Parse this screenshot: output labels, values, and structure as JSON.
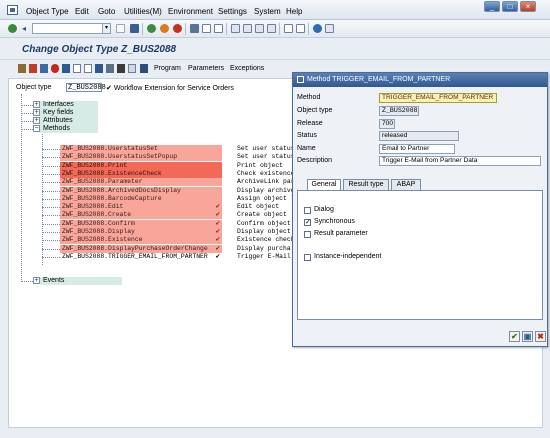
{
  "menubar": {
    "items": [
      "Object Type",
      "Edit",
      "Goto",
      "Utilities(M)",
      "Environment",
      "Settings",
      "System",
      "Help"
    ]
  },
  "window_controls": [
    "minimize-icon",
    "maximize-icon",
    "close-icon"
  ],
  "title": "Change Object Type Z_BUS2088",
  "app_toolbar": {
    "buttons": [
      "Program",
      "Parameters",
      "Exceptions"
    ]
  },
  "object_type": {
    "label": "Object type",
    "value": "Z_BUS2088",
    "description": "Workflow Extension for Service Orders"
  },
  "tree": {
    "nodes": [
      "Interfaces",
      "Key fields",
      "Attributes",
      "Methods",
      "Events"
    ],
    "methods": [
      {
        "name": "ZWF_BUS2088.UserstatusSet",
        "desc": "Set user status",
        "state": "red",
        "checked": false
      },
      {
        "name": "ZWF_BUS2088.UserstatusSetPopup",
        "desc": "Set user status",
        "state": "red",
        "checked": false
      },
      {
        "name": "ZWF_BUS2088.Print",
        "desc": "Print object",
        "state": "redsel",
        "checked": false
      },
      {
        "name": "ZWF_BUS2088.ExistenceCheck",
        "desc": "Check existence",
        "state": "redsel",
        "checked": false
      },
      {
        "name": "ZWF_BUS2088.Parameter",
        "desc": "ArchiveLink par",
        "state": "red",
        "checked": false
      },
      {
        "name": "ZWF_BUS2088.ArchivedDocsDisplay",
        "desc": "Display archive",
        "state": "red",
        "checked": false
      },
      {
        "name": "ZWF_BUS2088.BarcodeCapture",
        "desc": "Assign object l",
        "state": "red",
        "checked": false
      },
      {
        "name": "ZWF_BUS2088.Edit",
        "desc": "Edit object",
        "state": "red",
        "checked": true
      },
      {
        "name": "ZWF_BUS2088.Create",
        "desc": "Create object",
        "state": "red",
        "checked": true
      },
      {
        "name": "ZWF_BUS2088.Confirm",
        "desc": "Confirm object",
        "state": "red",
        "checked": true
      },
      {
        "name": "ZWF_BUS2088.Display",
        "desc": "Display object",
        "state": "red",
        "checked": true
      },
      {
        "name": "ZWF_BUS2088.Existence",
        "desc": "Existence check",
        "state": "red",
        "checked": true
      },
      {
        "name": "ZWF_BUS2088.DisplayPurchaseOrderChange",
        "desc": "Display purcha",
        "state": "red",
        "checked": true
      },
      {
        "name": "ZWF_BUS2088.TRIGGER_EMAIL_FROM_PARTNER",
        "desc": "Trigger E-Mail",
        "state": "white",
        "checked": true
      }
    ]
  },
  "dialog": {
    "title": "Method TRIGGER_EMAIL_FROM_PARTNER",
    "fields": {
      "method_label": "Method",
      "method_value": "TRIGGER_EMAIL_FROM_PARTNER",
      "object_type_label": "Object type",
      "object_type_value": "Z_BUS2088",
      "release_label": "Release",
      "release_value": "700",
      "status_label": "Status",
      "status_value": "released",
      "name_label": "Name",
      "name_value": "Email to Partner",
      "description_label": "Description",
      "description_value": "Trigger E-Mail from Partner Data"
    },
    "tabs": [
      "General",
      "Result type",
      "ABAP"
    ],
    "active_tab": "General",
    "checkboxes": [
      {
        "label": "Dialog",
        "checked": false
      },
      {
        "label": "Synchronous",
        "checked": true
      },
      {
        "label": "Result parameter",
        "checked": false
      },
      {
        "label": "Instance-independent",
        "checked": false
      }
    ],
    "buttons": [
      "confirm-icon",
      "copy-icon",
      "cancel-icon"
    ]
  },
  "colors": {
    "title_text": "#1b3a63",
    "method_red": "#f8a59a",
    "method_red_selected": "#f26a57",
    "tree_node": "#d7ebe6",
    "dialog_title": "#2f5990",
    "highlight_field": "#f6f4b5"
  }
}
